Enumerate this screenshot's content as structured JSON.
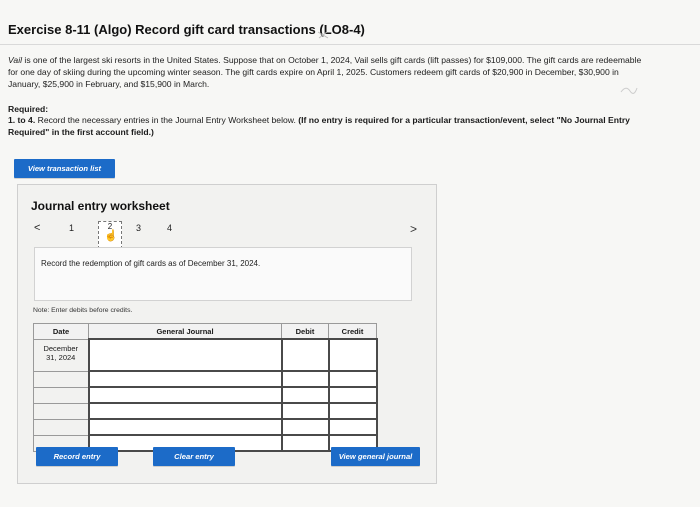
{
  "header": {
    "title": "Exercise 8-11 (Algo) Record gift card transactions (LO8-4)"
  },
  "intro": {
    "company_italic": "Vail",
    "text": " is one of the largest ski resorts in the United States. Suppose that on October 1, 2024, Vail sells gift cards (lift passes) for $109,000. The gift cards are redeemable for one day of skiing during the upcoming winter season. The gift cards expire on April 1, 2025. Customers redeem gift cards of $20,900 in December, $30,900 in January, $25,900 in February, and $15,900 in March."
  },
  "required": {
    "heading": "Required:",
    "prefix": "1. to 4.",
    "text": " Record the necessary entries in the Journal Entry Worksheet below. ",
    "bold_text": "(If no entry is required for a particular transaction/event, select \"No Journal Entry Required\" in the first account field.)"
  },
  "buttons": {
    "view_transactions": "View transaction list",
    "record_entry": "Record entry",
    "clear_entry": "Clear entry",
    "view_journal": "View general journal"
  },
  "worksheet": {
    "title": "Journal entry worksheet",
    "prev_icon": "<",
    "next_icon": ">",
    "pages": [
      "1",
      "2",
      "3",
      "4"
    ],
    "active_page": "2",
    "prompt": "Record the redemption of gift cards as of December 31, 2024.",
    "note": "Note: Enter debits before credits.",
    "table": {
      "headers": {
        "date": "Date",
        "journal": "General Journal",
        "debit": "Debit",
        "credit": "Credit"
      },
      "first_date_line1": "December",
      "first_date_line2": "31, 2024"
    }
  },
  "colors": {
    "button_blue": "#1c6bc8",
    "table_border": "#4a4a4a"
  },
  "icons": {
    "cursor": "pointing-hand-icon"
  }
}
